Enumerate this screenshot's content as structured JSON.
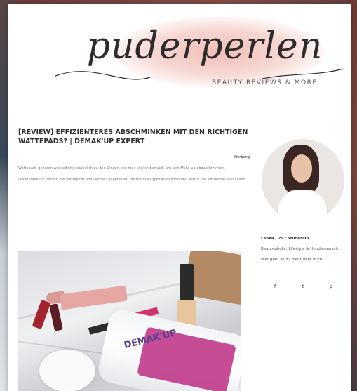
{
  "header": {
    "logo_text": "puderperlen",
    "tagline": "BEAUTY REVIEWS & MORE"
  },
  "post": {
    "title": "[REVIEW] EFFIZIENTERES ABSCHMINKEN MIT DEN RICHTIGEN WATTEPADS? | DEMAK'UP EXPERT",
    "date": "",
    "paragraph_right": "Werbung",
    "paragraph1": "Wattepads gehören wie selbstverständlich zu den Dingen, die man täglich benutzt, um sein Make-up abzuschminken.",
    "paragraph2": "Dabei habe ich neulich die Wattepads von Demak'Up getestet, die mit ihrer speziellen Form und Textur viel effizienter sein sollen."
  },
  "hero_image": {
    "product_text": "DEMAK'UP"
  },
  "sidebar": {
    "heading": "",
    "bio_name": "Lenka / 25 / Studentin",
    "bio_line": "Beauteaholic, Lifestyle & Hundemensch",
    "bio_more": "Hier geht es zu mehr über mich.",
    "social_heading": "",
    "social": [
      {
        "icon": "facebook-icon",
        "glyph": "f",
        "label": ""
      },
      {
        "icon": "twitter-icon",
        "glyph": "t",
        "label": ""
      },
      {
        "icon": "pinterest-icon",
        "glyph": "p",
        "label": ""
      }
    ]
  },
  "colors": {
    "accent_pink": "#eeb2aa",
    "text_dark": "#2f2f2f"
  }
}
